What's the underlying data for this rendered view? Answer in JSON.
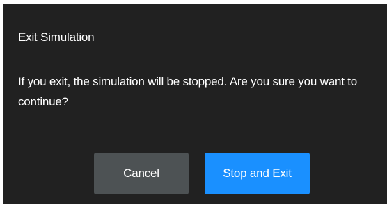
{
  "dialog": {
    "title": "Exit Simulation",
    "message": "If you exit, the simulation will be stopped. Are you sure you want to continue?",
    "buttons": {
      "cancel_label": "Cancel",
      "confirm_label": "Stop and Exit"
    }
  },
  "colors": {
    "dialog_background": "#212121",
    "divider": "#5a5a5a",
    "cancel_button": "#4d5254",
    "confirm_button": "#1a90ff",
    "text": "#ffffff"
  }
}
